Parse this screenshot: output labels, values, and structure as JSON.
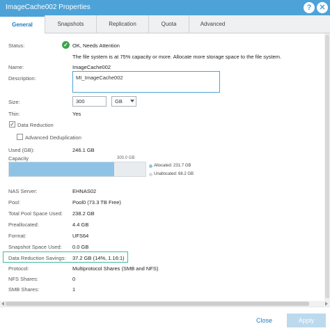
{
  "window": {
    "title": "ImageCache002 Properties",
    "help": "?",
    "close": "✕"
  },
  "tabs": [
    {
      "label": "General"
    },
    {
      "label": "Snapshots"
    },
    {
      "label": "Replication"
    },
    {
      "label": "Quota"
    },
    {
      "label": "Advanced"
    }
  ],
  "general": {
    "status_label": "Status:",
    "status_value": "OK, Needs Attention",
    "status_message": "The file system is at 75% capacity or more. Allocate more storage space to the file system.",
    "name_label": "Name:",
    "name_value": "ImageCache002",
    "description_label": "Description:",
    "description_value": "MI_ImageCache002",
    "size_label": "Size:",
    "size_value": "300",
    "size_unit": "GB",
    "thin_label": "Thin:",
    "thin_value": "Yes",
    "data_reduction_label": "Data Reduction",
    "data_reduction_checked": true,
    "advanced_dedup_label": "Advanced Deduplication",
    "advanced_dedup_checked": false,
    "used_label": "Used (GB):",
    "used_value": "246.1 GB",
    "capacity_label": "Capacity",
    "capacity_max": "300.0 GB",
    "capacity_used_fraction": 0.772,
    "allocated_label": "Allocated: 231.7 GB",
    "unallocated_label": "Unallocated: 68.2 GB",
    "nas_server_label": "NAS Server:",
    "nas_server_value": "EHNAS02",
    "pool_label": "Pool:",
    "pool_value": "Pool0 (73.3 TB Free)",
    "total_pool_label": "Total Pool Space Used:",
    "total_pool_value": "238.2 GB",
    "preallocated_label": "Preallocated:",
    "preallocated_value": "4.4 GB",
    "format_label": "Format:",
    "format_value": "UFS64",
    "snapshot_space_label": "Snapshot Space Used:",
    "snapshot_space_value": "0.0 GB",
    "drs_label": "Data Reduction Savings:",
    "drs_value": "37.2 GB (14%, 1.16:1)",
    "protocol_label": "Protocol:",
    "protocol_value": "Multiprotocol Shares (SMB and NFS)",
    "nfs_label": "NFS Shares:",
    "nfs_value": "0",
    "smb_label": "SMB Shares:",
    "smb_value": "1"
  },
  "colors": {
    "accent": "#4da3d8",
    "ok": "#3fa34d",
    "allocated": "#8fc3e6",
    "highlight": "#3fb9a0"
  },
  "footer": {
    "close_label": "Close",
    "apply_label": "Apply"
  }
}
